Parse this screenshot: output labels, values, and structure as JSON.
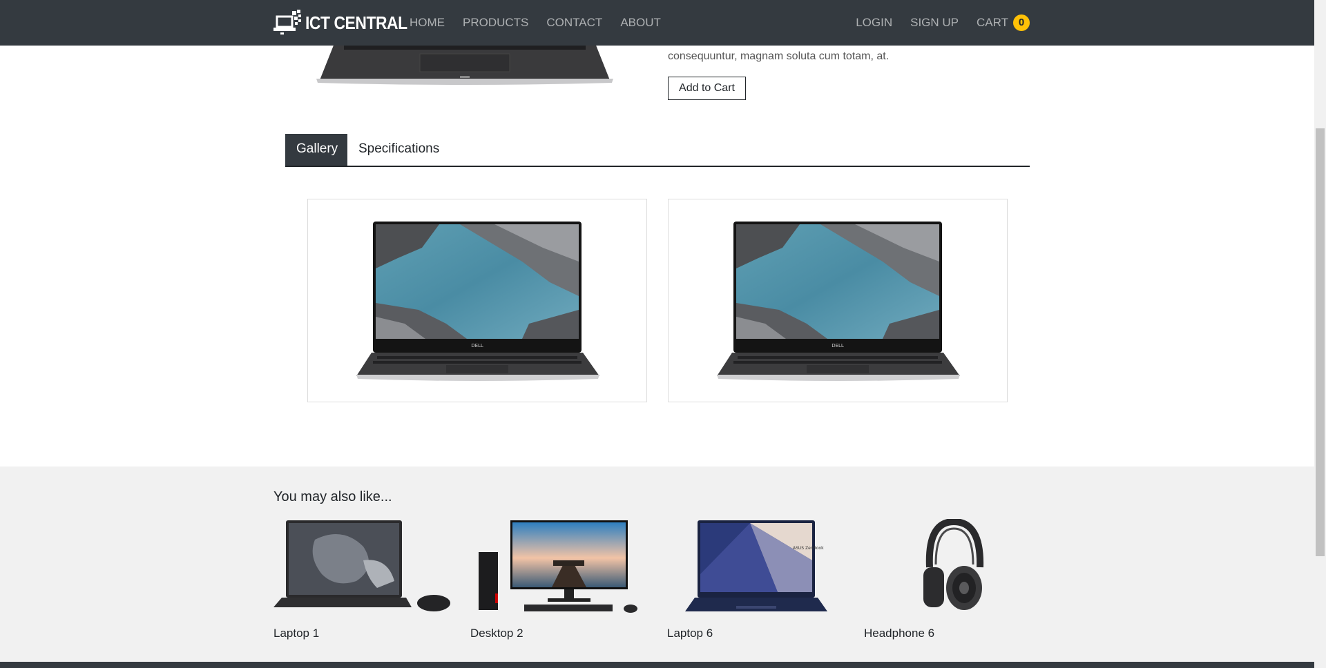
{
  "navbar": {
    "brand": "ICT CENTRAL",
    "left_links": [
      "HOME",
      "PRODUCTS",
      "CONTACT",
      "ABOUT"
    ],
    "login": "LOGIN",
    "signup": "SIGN UP",
    "cart_label": "CART",
    "cart_count": "0"
  },
  "product": {
    "description_tail": "consequuntur, magnam soluta cum totam, at.",
    "add_to_cart": "Add to Cart"
  },
  "tabs": {
    "gallery": "Gallery",
    "specifications": "Specifications",
    "active": "Gallery"
  },
  "gallery": {
    "images": [
      "laptop-image",
      "laptop-image"
    ],
    "laptop_brand_text": "DELL"
  },
  "recommendations": {
    "title": "You may also like...",
    "items": [
      {
        "name": "Laptop 1",
        "image": "laptop-dark-with-mouse"
      },
      {
        "name": "Desktop 2",
        "image": "desktop-tower-monitor"
      },
      {
        "name": "Laptop 6",
        "image": "laptop-blue"
      },
      {
        "name": "Headphone 6",
        "image": "headphones"
      }
    ]
  },
  "colors": {
    "navbar_bg": "#343a40",
    "cart_badge": "#ffc107",
    "section_bg": "#f1f1f1"
  }
}
